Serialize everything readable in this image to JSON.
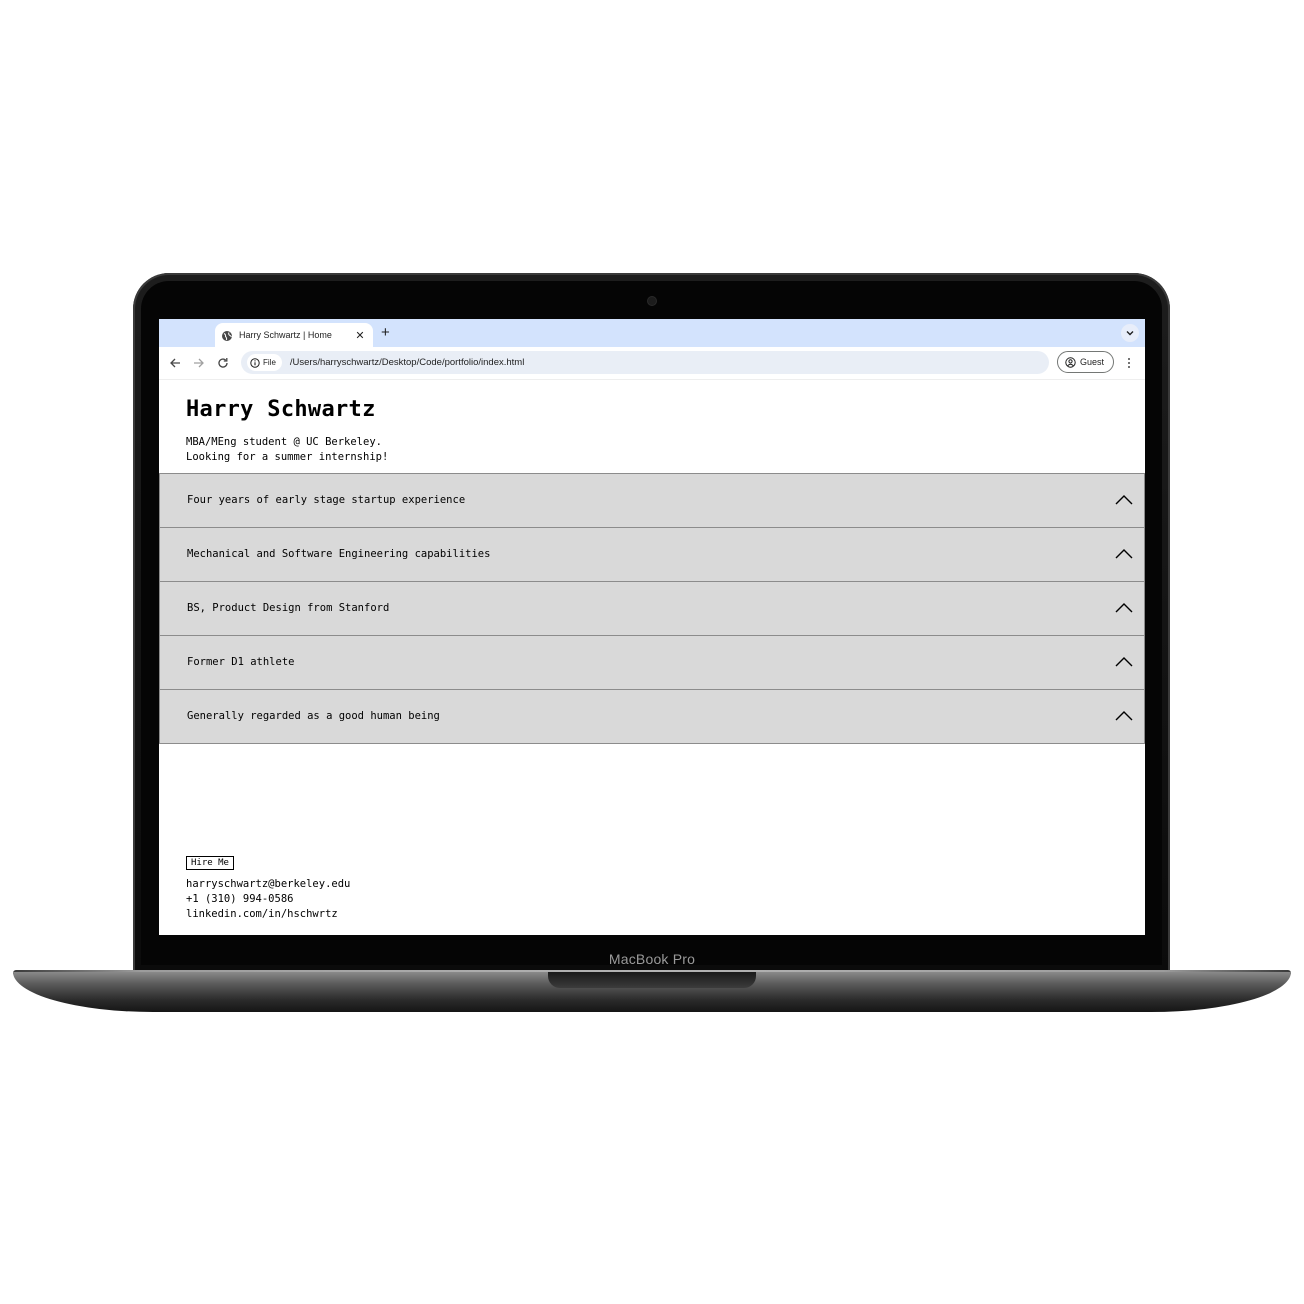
{
  "device": {
    "label": "MacBook Pro"
  },
  "browser": {
    "tab_title": "Harry Schwartz | Home",
    "tab_close": "✕",
    "new_tab": "+",
    "site_chip": "File",
    "url": "/Users/harryschwartz/Desktop/Code/portfolio/index.html",
    "profile_label": "Guest"
  },
  "page": {
    "name": "Harry Schwartz",
    "tagline": [
      "MBA/MEng student @ UC Berkeley.",
      "Looking for a summer internship!"
    ],
    "accordion": [
      {
        "label": "Four years of early stage startup experience"
      },
      {
        "label": "Mechanical and Software Engineering capabilities"
      },
      {
        "label": "BS, Product Design from Stanford"
      },
      {
        "label": "Former D1 athlete"
      },
      {
        "label": "Generally regarded as a good human being"
      }
    ],
    "hire_button": "Hire Me",
    "contact": {
      "email": "harryschwartz@berkeley.edu",
      "phone": "+1 (310) 994-0586",
      "linkedin": "linkedin.com/in/hschwrtz"
    }
  },
  "colors": {
    "tabbar": "#d3e3fd",
    "omnibox": "#e9eef6",
    "accordion_bg": "#d9d9d9",
    "accordion_border": "#8c8c8c"
  }
}
